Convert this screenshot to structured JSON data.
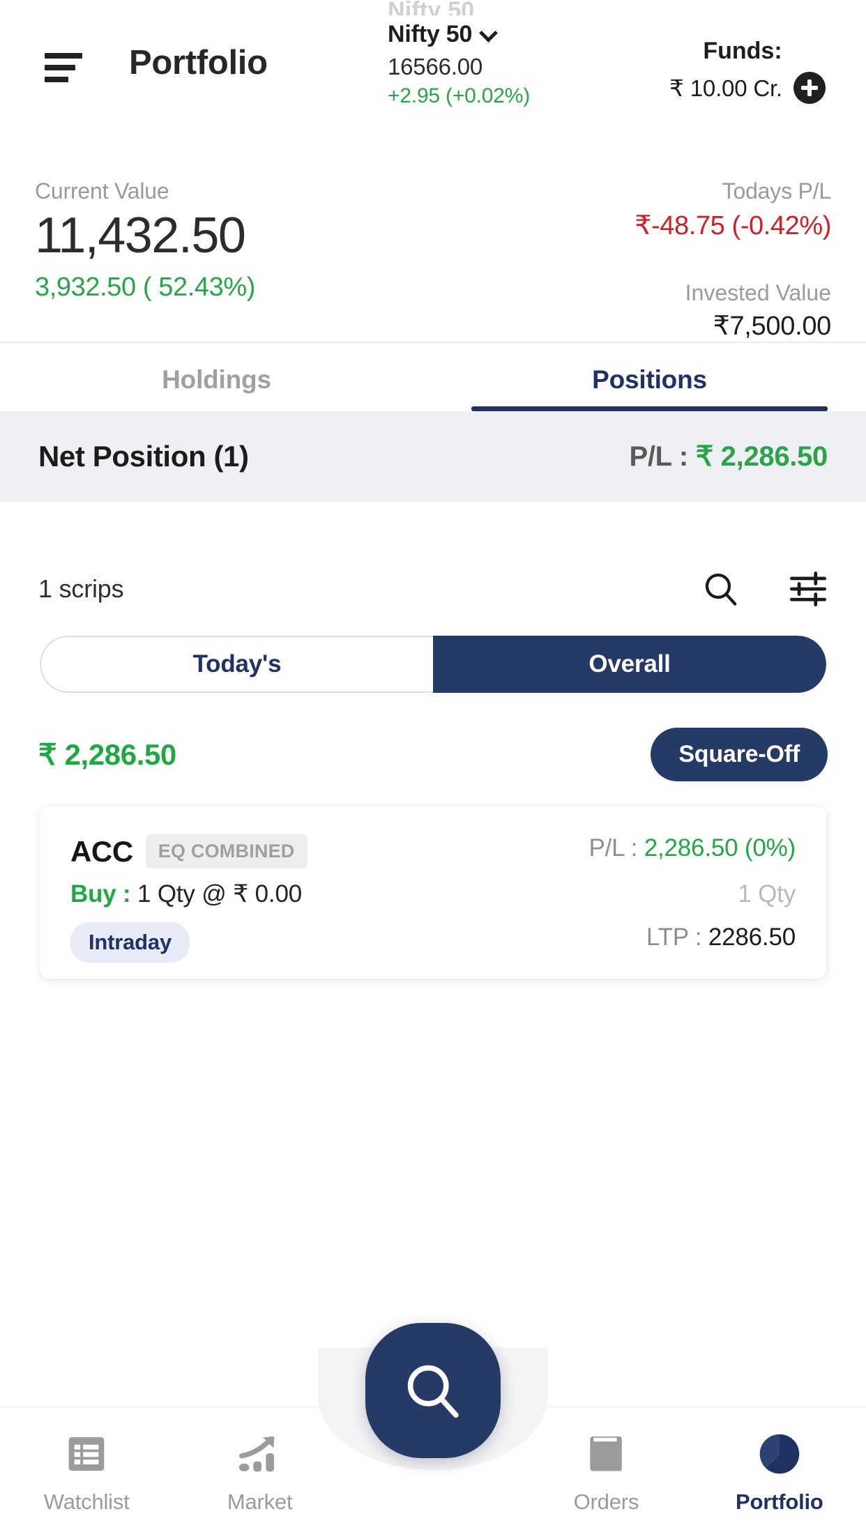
{
  "colors": {
    "brand_navy": "#253a65",
    "positive_green": "#22a745",
    "negative_red": "#cf2027",
    "muted_gray": "#9b9b9b",
    "band_gray": "#eef0f4"
  },
  "header": {
    "menu_icon": "hamburger-icon",
    "title": "Portfolio",
    "ghost_index_above": "Nifty 50",
    "index": {
      "name": "Nifty 50",
      "chevron_icon": "chevron-down-icon",
      "ltp": "16566.00",
      "change": "+2.95 (+0.02%)"
    },
    "funds": {
      "label": "Funds:",
      "amount": "₹ 10.00 Cr.",
      "add_icon": "plus-circle-icon"
    }
  },
  "summary": {
    "current_value_label": "Current Value",
    "current_value": "11,432.50",
    "overall_pl": "3,932.50 ( 52.43%)",
    "todays_pl_label": "Todays P/L",
    "todays_pl": "₹-48.75 (-0.42%)",
    "invested_value_label": "Invested Value",
    "invested_value": "₹7,500.00"
  },
  "tabs": [
    {
      "label": "Holdings",
      "active": false
    },
    {
      "label": "Positions",
      "active": true
    }
  ],
  "net_position": {
    "title": "Net Position (1)",
    "pl_label": "P/L :",
    "pl_value": "₹ 2,286.50"
  },
  "list_controls": {
    "count_label": "1 scrips",
    "search_icon": "search-icon",
    "filter_icon": "filter-sliders-icon"
  },
  "period_toggle": [
    {
      "label": "Today's",
      "active": false
    },
    {
      "label": "Overall",
      "active": true
    }
  ],
  "pl_bar": {
    "amount": "₹ 2,286.50",
    "square_off_label": "Square-Off"
  },
  "positions": [
    {
      "symbol": "ACC",
      "exchange_chip": "EQ COMBINED",
      "side_label": "Buy :",
      "side_detail": "1 Qty @ ₹ 0.00",
      "product_chip": "Intraday",
      "pl_label": "P/L :",
      "pl_value": "2,286.50 (0%)",
      "qty": "1 Qty",
      "ltp_label": "LTP :",
      "ltp_value": "2286.50"
    }
  ],
  "fab": {
    "icon": "search-icon"
  },
  "bottom_nav": [
    {
      "label": "Watchlist",
      "icon": "list-icon",
      "active": false
    },
    {
      "label": "Market",
      "icon": "growth-chart-icon",
      "active": false
    },
    {
      "label": "Orders",
      "icon": "book-icon",
      "active": false
    },
    {
      "label": "Portfolio",
      "icon": "pie-chart-icon",
      "active": true
    }
  ]
}
